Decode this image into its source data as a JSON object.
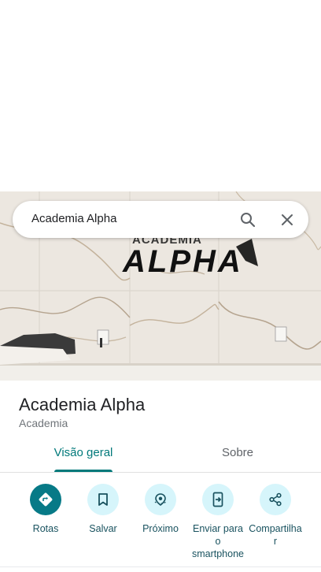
{
  "search": {
    "query": "Academia Alpha"
  },
  "hero": {
    "sign_text": "ALPHA"
  },
  "place": {
    "name": "Academia Alpha",
    "category": "Academia"
  },
  "tabs": [
    {
      "label": "Visão geral",
      "selected": true
    },
    {
      "label": "Sobre",
      "selected": false
    }
  ],
  "actions": [
    {
      "label": "Rotas",
      "icon": "directions-icon"
    },
    {
      "label": "Salvar",
      "icon": "bookmark-icon"
    },
    {
      "label": "Próximo",
      "icon": "nearby-icon"
    },
    {
      "label": "Enviar para\no\nsmartphone",
      "icon": "send-to-phone-icon"
    },
    {
      "label": "Compartilha\nr",
      "icon": "share-icon"
    }
  ],
  "colors": {
    "accent": "#01797a",
    "action_bg": "#d6f5fb",
    "primary_action_bg": "#077a87"
  }
}
